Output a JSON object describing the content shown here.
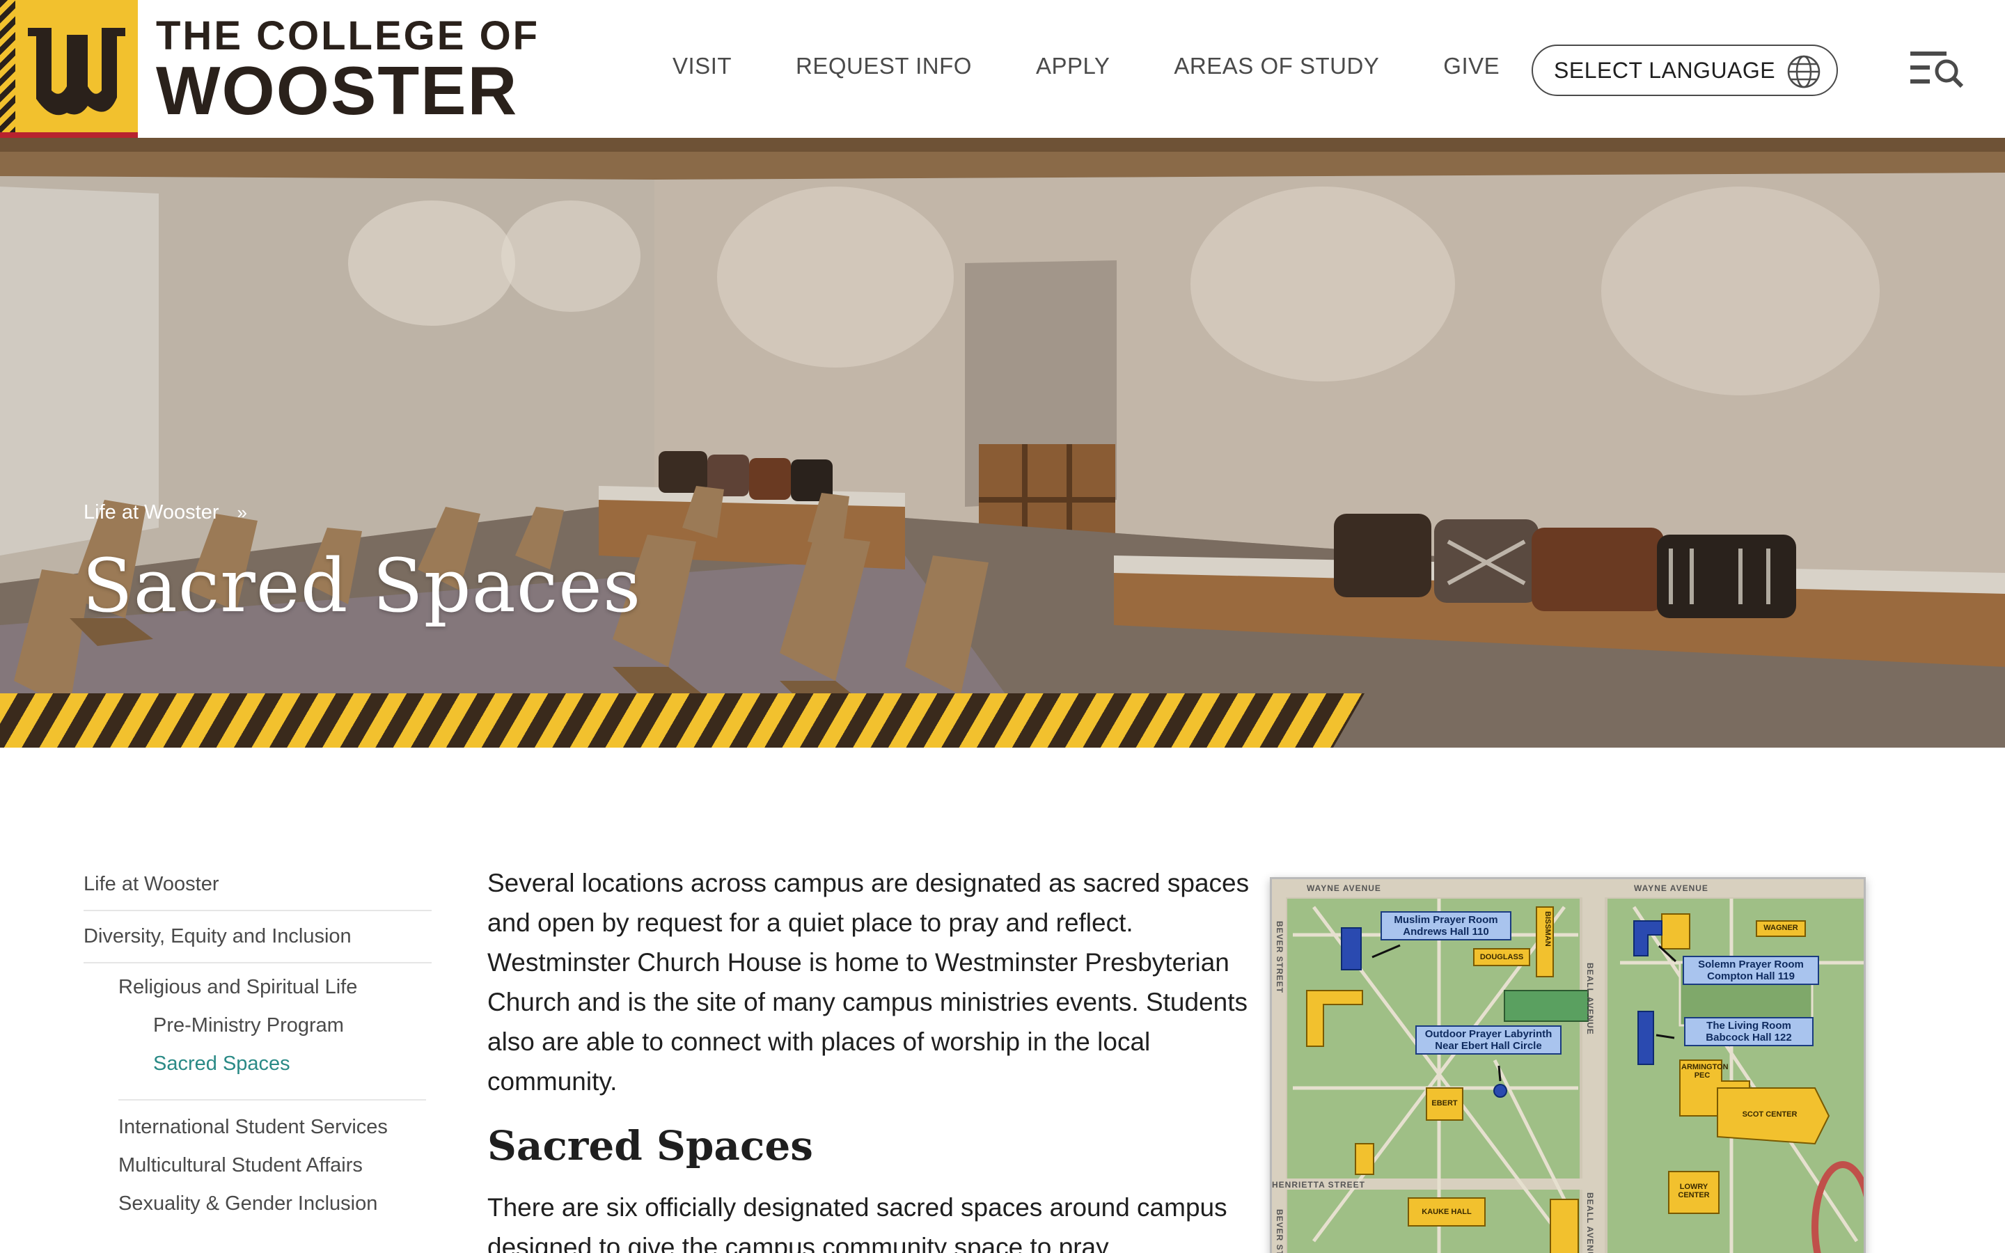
{
  "brand": {
    "line1": "THE COLLEGE OF",
    "line2": "WOOSTER",
    "colors": {
      "gold": "#f2c12e",
      "dark": "#2a211b",
      "red": "#b8232f"
    }
  },
  "nav": {
    "items": [
      "VISIT",
      "REQUEST INFO",
      "APPLY",
      "AREAS OF STUDY",
      "GIVE"
    ],
    "language_label": "SELECT LANGUAGE",
    "language_icon": "globe-icon",
    "menu_icon": "menu-search-icon"
  },
  "hero": {
    "breadcrumb": {
      "parent": "Life at Wooster",
      "separator": "»"
    },
    "title": "Sacred Spaces"
  },
  "sidebar": {
    "items": [
      {
        "label": "Life at Wooster"
      },
      {
        "label": "Diversity, Equity and Inclusion"
      },
      {
        "label": "Religious and Spiritual Life"
      },
      {
        "label": "Pre-Ministry Program"
      },
      {
        "label": "Sacred Spaces",
        "active": true
      },
      {
        "label": "International Student Services"
      },
      {
        "label": "Multicultural Student Affairs"
      },
      {
        "label": "Sexuality & Gender Inclusion"
      }
    ],
    "active_color": "#2a8a86"
  },
  "main": {
    "intro": "Several locations across campus are designated as sacred spaces and open by request for a quiet place to pray and reflect. Westminster Church House is home to Westminster Presbyterian Church and is the site of many campus ministries events. Students also are able to connect with places of worship in the local community.",
    "heading": "Sacred Spaces",
    "para2": "There are six officially designated sacred spaces around campus designed to give the campus community space to pray,"
  },
  "map": {
    "streets": [
      "WAYNE AVENUE",
      "WAYNE AVENUE",
      "BEALL AVENUE",
      "BEVER STREET",
      "BEALL AVENUE",
      "HENRIETTA STREET",
      "BEVER ST"
    ],
    "labels": {
      "muslim": [
        "Muslim Prayer Room",
        "Andrews Hall 110"
      ],
      "solemn": [
        "Solemn Prayer Room",
        "Compton Hall 119"
      ],
      "labyrinth": [
        "Outdoor Prayer Labyrinth",
        "Near Ebert Hall Circle"
      ],
      "living": [
        "The Living Room",
        "Babcock Hall 122"
      ]
    },
    "buildings": {
      "douglass": "DOUGLASS",
      "bissman": "BISSMAN",
      "wagner": "WAGNER",
      "armington": "ARMINGTON PEC",
      "scot": "SCOT CENTER",
      "ebert": "EBERT",
      "kauke": "KAUKE HALL",
      "lowry": "LOWRY CENTER"
    }
  }
}
